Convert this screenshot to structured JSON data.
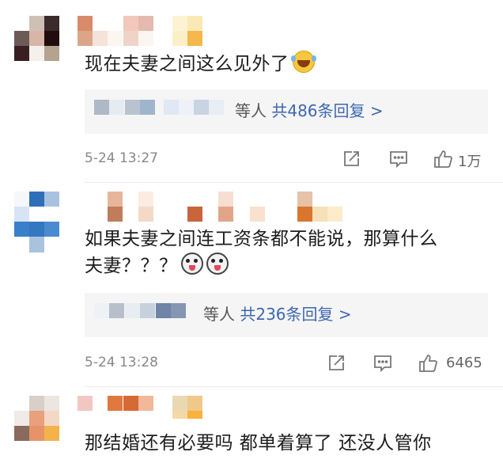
{
  "comments": [
    {
      "text": "现在夫妻之间这么见外了",
      "emoji": "face-with-tears-of-joy",
      "reply_prefix": "等人",
      "reply_link": "共486条回复 >",
      "time": "5-24 13:27",
      "likes": "1万"
    },
    {
      "text_line1": "如果夫妻之间连工资条都不能说，那算什么",
      "text_line2": "夫妻？？？",
      "emoji": "dog-face",
      "reply_prefix": "等人",
      "reply_link": "共236条回复 >",
      "time": "5-24 13:28",
      "likes": "6465"
    },
    {
      "text": "那结婚还有必要吗 都单着算了 还没人管你"
    }
  ],
  "icons": {
    "share": "share-icon",
    "comment": "comment-icon",
    "like": "thumbs-up-icon"
  },
  "colors": {
    "link": "#3d67b0",
    "muted": "#888888",
    "reply_bg": "#f5f5f5"
  }
}
